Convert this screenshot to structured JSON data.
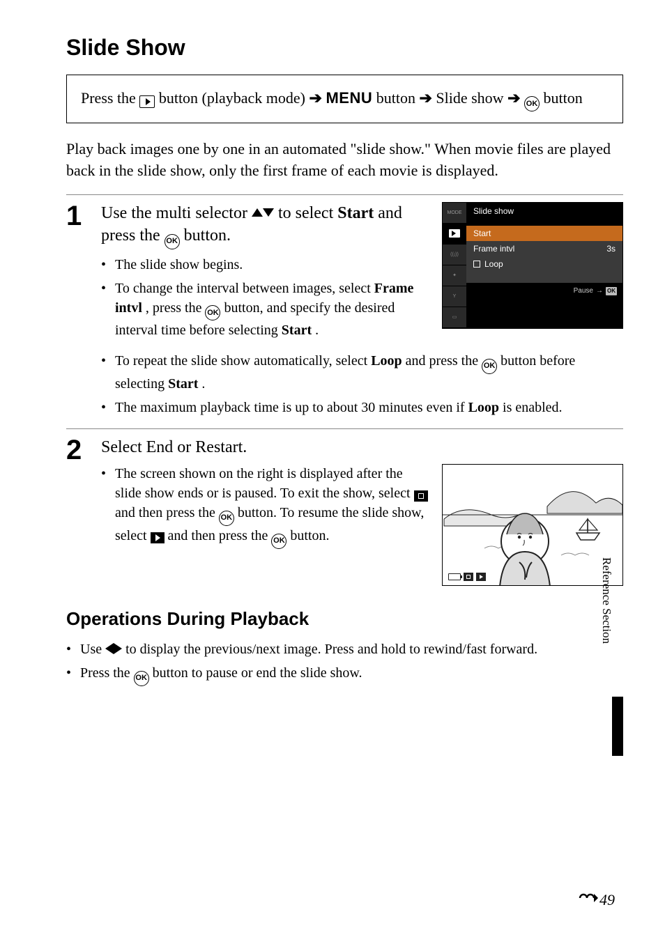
{
  "title": "Slide Show",
  "path": {
    "prefix": "Press the ",
    "seg1": " button (playback mode) ",
    "menu": "MENU",
    "seg2": " button ",
    "seg3": " Slide show ",
    "seg4": " button"
  },
  "intro": "Play back images one by one in an automated \"slide show.\" When movie files are played back in the slide show, only the first frame of each movie is displayed.",
  "step1": {
    "num": "1",
    "head_a": "Use the multi selector ",
    "head_b": " to select ",
    "head_c": "Start",
    "head_d": " and press the ",
    "head_e": " button.",
    "b1": "The slide show begins.",
    "b2a": "To change the interval between images, select ",
    "b2b": "Frame intvl",
    "b2c": ", press the ",
    "b2d": " button, and specify the desired interval time before selecting ",
    "b2e": "Start",
    "b2f": ".",
    "b3a": "To repeat the slide show automatically, select ",
    "b3b": "Loop",
    "b3c": " and press the ",
    "b3d": " button before selecting ",
    "b3e": "Start",
    "b3f": ".",
    "b4a": "The maximum playback time is up to about 30 minutes even if ",
    "b4b": "Loop",
    "b4c": " is enabled."
  },
  "lcd": {
    "sidebar_mode": "MODE",
    "title": "Slide show",
    "row1": "Start",
    "row2_label": "Frame intvl",
    "row2_value": "3s",
    "row3": "Loop",
    "footer": "Pause",
    "footer_ok": "OK"
  },
  "step2": {
    "num": "2",
    "head": "Select End or Restart.",
    "b1a": "The screen shown on the right is displayed after the slide show ends or is paused. To exit the show, select ",
    "b1b": " and then press the ",
    "b1c": " button. To resume the slide show, select ",
    "b1d": " and then press the ",
    "b1e": " button."
  },
  "ops": {
    "heading": "Operations During Playback",
    "b1a": "Use ",
    "b1b": " to display the previous/next image. Press and hold to rewind/fast forward.",
    "b2a": "Press the ",
    "b2b": " button to pause or end the slide show."
  },
  "side_label": "Reference Section",
  "page_number": "49"
}
